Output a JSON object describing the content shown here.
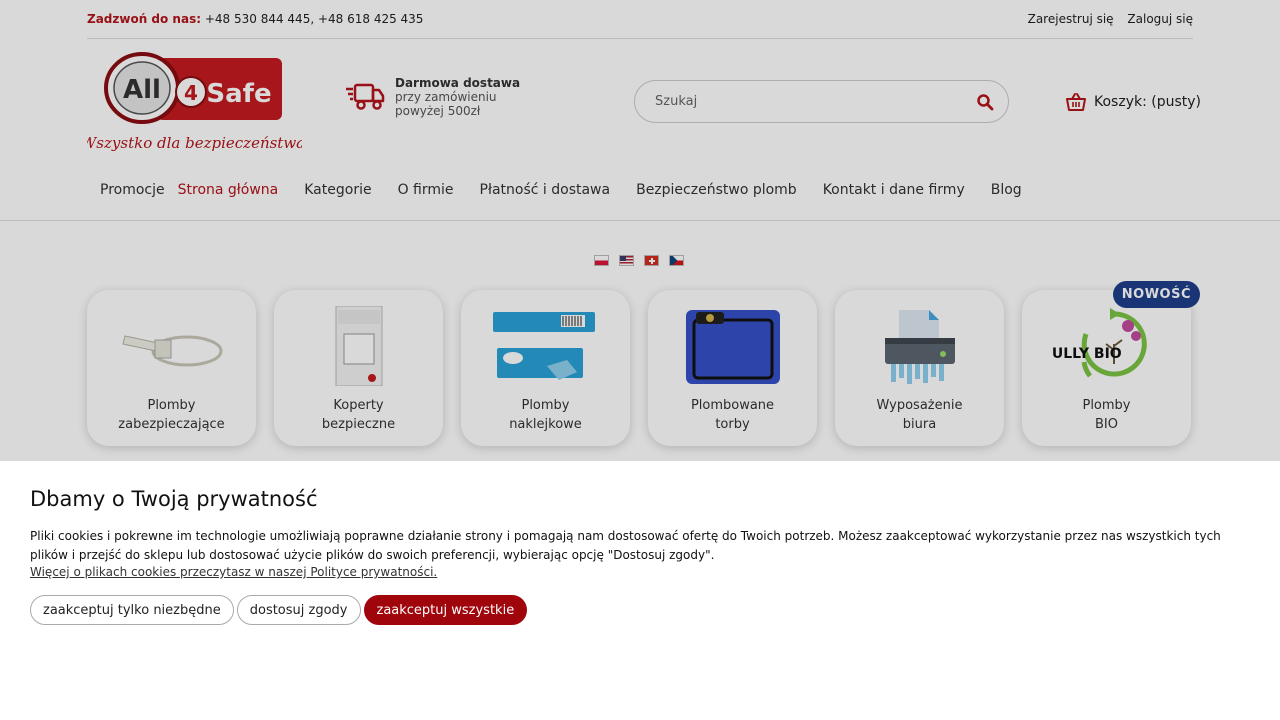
{
  "topbar": {
    "phone_label": "Zadzwoń do nas:",
    "phone_numbers": " +48 530 844 445, +48 618 425 435",
    "register": "Zarejestruj się",
    "login": "Zaloguj się"
  },
  "header": {
    "logo_text": "All 4 Safe",
    "logo_tagline": "Wszystko dla bezpieczeństwa",
    "delivery_title": "Darmowa dostawa",
    "delivery_line1": "przy zamówieniu",
    "delivery_line2": "powyżej 500zł",
    "search_placeholder": "Szukaj",
    "cart_label": "Koszyk: (pusty)"
  },
  "nav": {
    "items": [
      {
        "label": "Promocje",
        "active": false
      },
      {
        "label": "Strona główna",
        "active": true
      },
      {
        "label": "Kategorie",
        "active": false
      },
      {
        "label": "O firmie",
        "active": false
      },
      {
        "label": "Płatność i dostawa",
        "active": false
      },
      {
        "label": "Bezpieczeństwo plomb",
        "active": false
      },
      {
        "label": "Kontakt i dane firmy",
        "active": false
      },
      {
        "label": "Blog",
        "active": false
      }
    ]
  },
  "languages": [
    "pl",
    "us",
    "ch",
    "cz"
  ],
  "categories": [
    {
      "line1": "Plomby",
      "line2": "zabezpieczające",
      "icon": "cable-seal-icon"
    },
    {
      "line1": "Koperty",
      "line2": "bezpieczne",
      "icon": "security-envelope-icon"
    },
    {
      "line1": "Plomby",
      "line2": "naklejkowe",
      "icon": "sticker-seal-icon"
    },
    {
      "line1": "Plombowane",
      "line2": "torby",
      "icon": "sealed-bag-icon"
    },
    {
      "line1": "Wyposażenie",
      "line2": "biura",
      "icon": "shredder-icon"
    },
    {
      "line1": "Plomby",
      "line2": "BIO",
      "icon": "fully-bio-icon",
      "badge": "NOWOŚĆ",
      "logo_text": "FULLY BIO"
    }
  ],
  "cookie": {
    "title": "Dbamy o Twoją prywatność",
    "text": "Pliki cookies i pokrewne im technologie umożliwiają poprawne działanie strony i pomagają nam dostosować ofertę do Twoich potrzeb. Możesz zaakceptować wykorzystanie przez nas wszystkich tych plików i przejść do sklepu lub dostosować użycie plików do swoich preferencji, wybierając opcję \"Dostosuj zgody\".",
    "more_link": "Więcej o plikach cookies przeczytasz w naszej Polityce prywatności.",
    "btn_necessary": "zaakceptuj tylko niezbędne",
    "btn_customize": "dostosuj zgody",
    "btn_accept_all": "zaakceptuj wszystkie"
  },
  "colors": {
    "brand_red": "#b3151b",
    "accept_red": "#a0050c",
    "badge_blue": "#1e3f8a"
  }
}
